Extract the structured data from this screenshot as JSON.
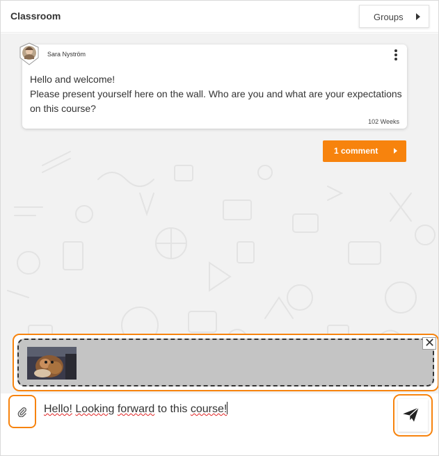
{
  "header": {
    "title": "Classroom",
    "groups_label": "Groups"
  },
  "post": {
    "author": "Sara Nyström",
    "lines": [
      "Hello and welcome!",
      "Please present yourself here on the wall. Who are you and what are your expectations",
      "on this course?"
    ],
    "time": "102 Weeks",
    "comment_label": "1 comment"
  },
  "composer": {
    "words": [
      "Hello!",
      "Looking",
      "forward",
      "to",
      "this",
      "course!"
    ],
    "close_symbol": "✕"
  },
  "colors": {
    "accent": "#f7830d",
    "wall_bg": "#f2f2f2",
    "attach_bg": "#c4c4c4"
  },
  "icons": {
    "attach": "paperclip-icon",
    "send": "paper-plane-icon",
    "menu": "kebab-menu-icon",
    "close": "close-icon"
  }
}
